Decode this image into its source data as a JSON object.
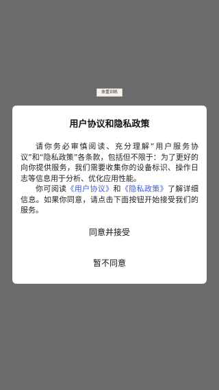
{
  "background": {
    "badge_text": "体重训练",
    "overlay_color": "#6b6b6b"
  },
  "dialog": {
    "title": "用户协议和隐私政策",
    "paragraph1": "请你务必审慎阅读、充分理解“用户服务协议”和“隐私政策”各条款，包括但不限于：为了更好的向你提供服务，我们需要收集你的设备标识、操作日志等信息用于分析、优化应用性能。",
    "paragraph2_prefix": "你可阅读",
    "user_agreement_link": "《用户协议》",
    "paragraph2_and": "和",
    "privacy_policy_link": "《隐私政策》",
    "paragraph2_suffix": "了解详细信息。如果你同意，请点击下面按钮开始接受我们的服务。",
    "accept_label": "同意并接受",
    "reject_label": "暂不同意",
    "link_color": "#3c5cd6"
  }
}
